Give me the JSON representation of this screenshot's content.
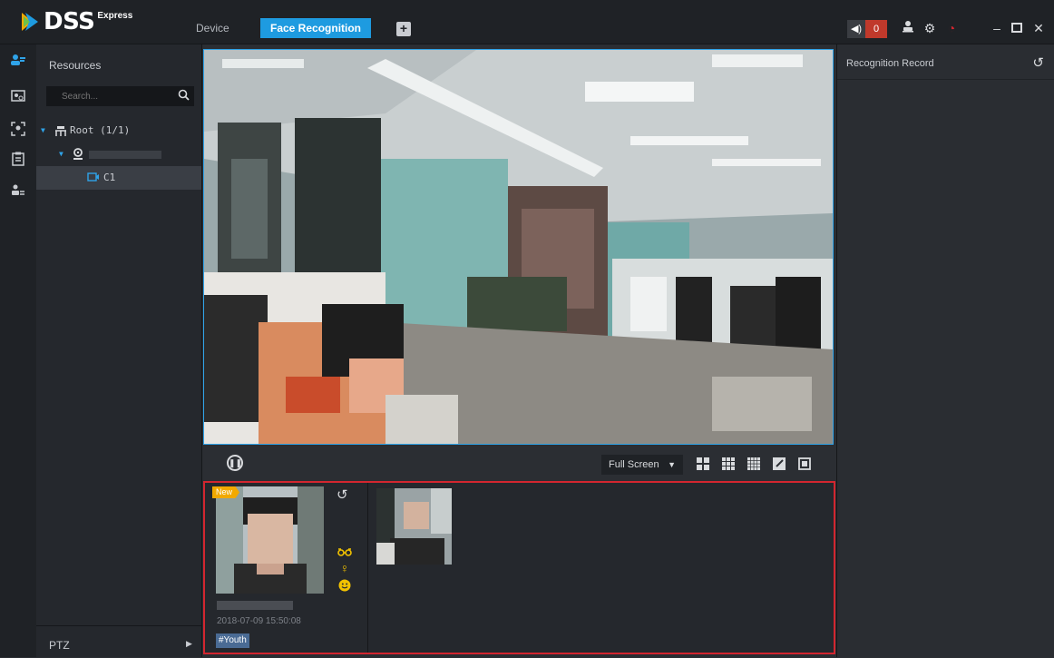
{
  "app": {
    "name": "DSS",
    "edition": "Express"
  },
  "tabs": [
    {
      "label": "Device",
      "active": false
    },
    {
      "label": "Face Recognition",
      "active": true
    }
  ],
  "header": {
    "alarm_count": "0",
    "accent": "#1e9be0",
    "alarm_color": "#c0392b"
  },
  "resources": {
    "title": "Resources",
    "search_placeholder": "Search...",
    "tree": {
      "root_label": "Root (1/1)",
      "channel_label": "C1"
    },
    "ptz_label": "PTZ"
  },
  "video_toolbar": {
    "screen_mode": "Full Screen"
  },
  "capture": {
    "badge": "New",
    "timestamp": "2018-07-09 15:50:08",
    "tag": "#Youth",
    "attributes": [
      "glasses-icon",
      "female-icon",
      "smile-icon"
    ]
  },
  "record_panel": {
    "title": "Recognition Record"
  }
}
